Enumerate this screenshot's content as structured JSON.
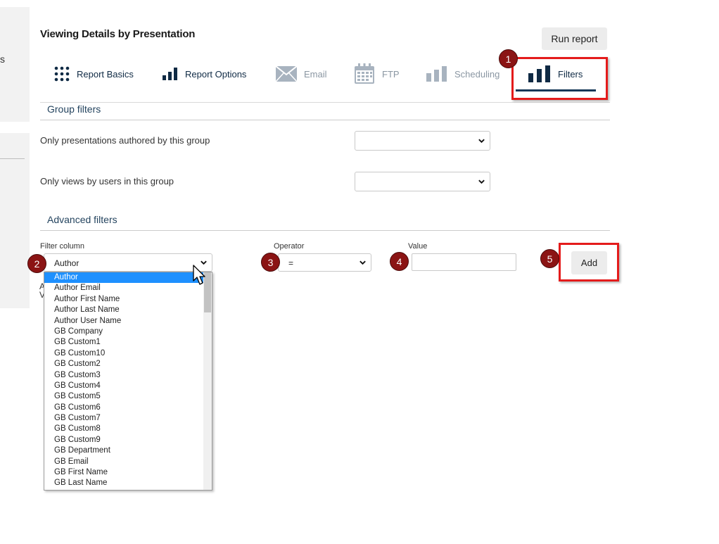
{
  "header": {
    "title": "Viewing Details by Presentation",
    "run_report_label": "Run report"
  },
  "left_partial_text": "s",
  "left_partial_text2": "A\nV",
  "tabs": [
    {
      "label": "Report Basics",
      "icon": "grid-dots-icon",
      "state": "enabled"
    },
    {
      "label": "Report Options",
      "icon": "bar-chart-icon",
      "state": "enabled"
    },
    {
      "label": "Email",
      "icon": "envelope-icon",
      "state": "disabled"
    },
    {
      "label": "FTP",
      "icon": "calendar-icon",
      "state": "disabled"
    },
    {
      "label": "Scheduling",
      "icon": "bar-chart-icon",
      "state": "disabled"
    },
    {
      "label": "Filters",
      "icon": "bar-chart-icon",
      "state": "active"
    }
  ],
  "group_filters": {
    "title": "Group filters",
    "authored_label": "Only presentations authored by this group",
    "authored_value": "",
    "views_label": "Only views by users in this group",
    "views_value": ""
  },
  "advanced_filters": {
    "title": "Advanced filters",
    "filter_column_label": "Filter column",
    "filter_column_value": "Author",
    "operator_label": "Operator",
    "operator_value": "=",
    "value_label": "Value",
    "value_value": "",
    "add_label": "Add"
  },
  "dropdown_options": [
    "Author",
    "Author Email",
    "Author First Name",
    "Author Last Name",
    "Author User Name",
    "GB Company",
    "GB Custom1",
    "GB Custom10",
    "GB Custom2",
    "GB Custom3",
    "GB Custom4",
    "GB Custom5",
    "GB Custom6",
    "GB Custom7",
    "GB Custom8",
    "GB Custom9",
    "GB Department",
    "GB Email",
    "GB First Name",
    "GB Last Name"
  ],
  "dropdown_selected_index": 0,
  "annotations": [
    "1",
    "2",
    "3",
    "4",
    "5"
  ],
  "colors": {
    "accent_navy": "#153757",
    "highlight_red": "#e41b1b",
    "badge_red": "#8b1414",
    "selected_blue": "#1e90ff"
  }
}
